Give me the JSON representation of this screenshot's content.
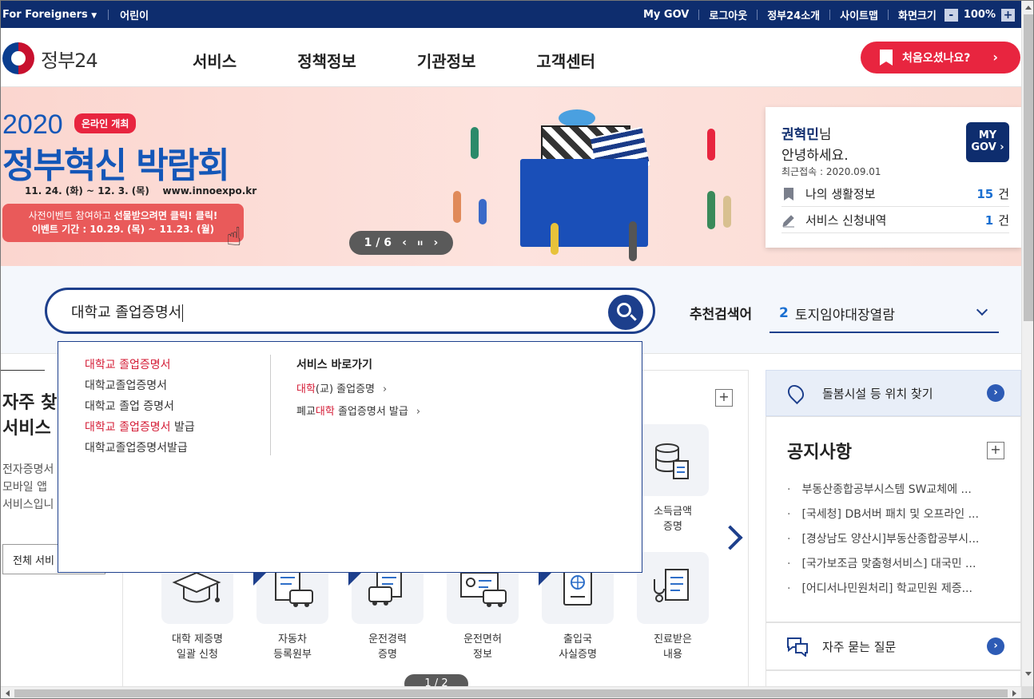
{
  "topbar": {
    "for_foreigners": "For Foreigners",
    "kids": "어린이",
    "my_gov": "My GOV",
    "logout": "로그아웃",
    "about": "정부24소개",
    "sitemap": "사이트맵",
    "screen_size": "화면크기",
    "zoom_minus": "-",
    "zoom_value": "100%",
    "zoom_plus": "+"
  },
  "header": {
    "logo_text": "정부24",
    "nav": [
      "서비스",
      "정책정보",
      "기관정보",
      "고객센터"
    ],
    "first_visit": "처음오셨나요?",
    "first_visit_chevron": "›"
  },
  "banner": {
    "year": "2020",
    "online_badge": "온라인 개최",
    "title": "정부혁신 박람회",
    "dates": "11. 24. (화) ~ 12. 3. (목)",
    "url": "www.innoexpo.kr",
    "event_line1_a": "사전이벤트 참여하고 ",
    "event_line1_b": "선물받으려면 클릭! 클릭!",
    "event_line2": "이벤트 기간 : 10.29. (목) ~ 11.23. (월)",
    "pager": "1 / 6",
    "pager_prev": "‹",
    "pager_pause": "ıı",
    "pager_next": "›"
  },
  "my_panel": {
    "name": "권혁민",
    "name_suffix": "님",
    "hello": "안녕하세요.",
    "last_access": "최근접속 : 2020.09.01",
    "mygov_btn_line1": "MY",
    "mygov_btn_line2": "GOV ›",
    "rows": [
      {
        "label": "나의 생활정보",
        "count": "15",
        "unit": "건"
      },
      {
        "label": "서비스 신청내역",
        "count": "1",
        "unit": "건"
      }
    ]
  },
  "search": {
    "value": "대학교 졸업증명서",
    "recommend_label": "추천검색어",
    "recommend_num": "2",
    "recommend_term": "토지임야대장열람"
  },
  "autocomplete": {
    "suggestions": [
      {
        "hl": "대학교 졸업증명서",
        "rest": ""
      },
      {
        "hl": "",
        "rest": "대학교졸업증명서"
      },
      {
        "hl": "",
        "rest": "대학교 졸업 증명서"
      },
      {
        "hl": "대학교 졸업증명서",
        "rest": " 발급"
      },
      {
        "hl": "",
        "rest": "대학교졸업증명서발급"
      }
    ],
    "shortcut_title": "서비스 바로가기",
    "shortcuts": [
      {
        "pre": "",
        "hl": "대학",
        "post": "(교) 졸업증명"
      },
      {
        "pre": "폐교",
        "hl": "대학",
        "post": " 졸업증명서 발급"
      }
    ],
    "shortcut_arrow": "›"
  },
  "left": {
    "title_line1": "자주 찾",
    "title_line2": "서비스",
    "desc_line1": "전자증명서",
    "desc_line2": "모바일 앱",
    "desc_line3": "서비스입니",
    "all_button": "전체 서비"
  },
  "services": {
    "plus": "+",
    "row1": [
      {
        "line1": "소득금액",
        "line2": "증명"
      }
    ],
    "row2": [
      {
        "line1": "대학 제증명",
        "line2": "일괄 신청"
      },
      {
        "line1": "자동차",
        "line2": "등록원부"
      },
      {
        "line1": "운전경력",
        "line2": "증명"
      },
      {
        "line1": "운전면허",
        "line2": "정보"
      },
      {
        "line1": "출입국",
        "line2": "사실증명"
      },
      {
        "line1": "진료받은",
        "line2": "내용"
      }
    ],
    "pager": "1 / 2"
  },
  "right": {
    "care_finder": "돌봄시설 등 위치 찾기",
    "notice_title": "공지사항",
    "notice_plus": "+",
    "notices": [
      "부동산종합공부시스템 SW교체에 ...",
      "[국세청] DB서버 패치 및 오프라인 ...",
      "[경상남도 양산시]부동산종합공부시...",
      "[국가보조금 맞춤형서비스] 대국민 ...",
      "[어디서나민원처리] 학교민원 제증..."
    ],
    "faq": "자주 묻는 질문",
    "arrow": "›"
  },
  "colors": {
    "navy": "#0e2d6e",
    "accent_red": "#e8253f",
    "link_blue": "#1a6fd1",
    "highlight": "#d41c36"
  }
}
